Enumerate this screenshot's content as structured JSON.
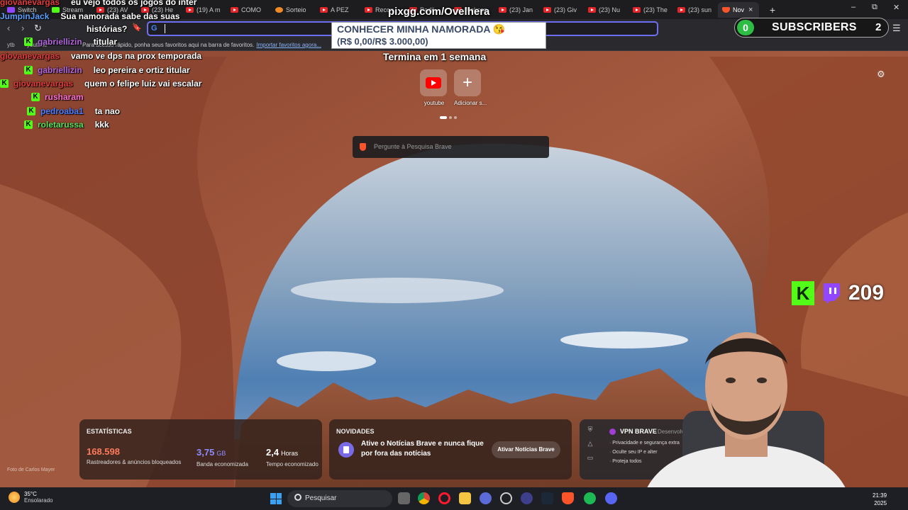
{
  "browser": {
    "tabs": [
      {
        "label": "Switch",
        "icon": "twitch-icon"
      },
      {
        "label": "Stream",
        "icon": "kick-icon"
      },
      {
        "label": "(23) AV",
        "icon": "youtube-icon"
      },
      {
        "label": "(23) He",
        "icon": "youtube-icon"
      },
      {
        "label": "(19) A m",
        "icon": "youtube-icon"
      },
      {
        "label": "COMO",
        "icon": "youtube-icon"
      },
      {
        "label": "Sorteio",
        "icon": "orange-icon"
      },
      {
        "label": "A PEZ",
        "icon": "youtube-icon"
      },
      {
        "label": "Recon",
        "icon": "youtube-icon"
      },
      {
        "label": "Padil",
        "icon": "youtube-icon"
      },
      {
        "label": "Aleksan",
        "icon": "youtube-icon"
      },
      {
        "label": "(23) Jan",
        "icon": "youtube-icon"
      },
      {
        "label": "(23) Giv",
        "icon": "youtube-icon"
      },
      {
        "label": "(23) Nu",
        "icon": "youtube-icon"
      },
      {
        "label": "(23) The",
        "icon": "youtube-icon"
      },
      {
        "label": "(23) sun",
        "icon": "youtube-icon"
      }
    ],
    "active_tab": {
      "label": "Nov",
      "close": "×"
    },
    "new_tab": "+",
    "window_controls": {
      "minimize": "–",
      "restore": "⧉",
      "close": "✕"
    },
    "nav": {
      "back": "‹",
      "forward": "›",
      "reload": "↻",
      "bookmark": "🔖"
    },
    "omnibox": {
      "engine_glyph": "G",
      "value": ""
    },
    "bookmarks_bar": {
      "text": "Para acesso rápido, ponha seus favoritos aqui na barra de favoritos.",
      "link": "Importar favoritos agora...",
      "left_labels": [
        "ytb",
        "youtube"
      ]
    },
    "menu_glyph": "☰"
  },
  "overlay": {
    "pix_url": "pixgg.com/Ovelhera",
    "goal_title": "CONHECER MINHA NAMORADA 😘",
    "goal_progress": "(R$ 0,00/R$ 3.000,00)",
    "goal_end": "Termina em 1 semana",
    "subs_count": "0",
    "subs_label": "SUBSCRIBERS",
    "subs_right": "2",
    "viewer_count": "209",
    "chat": [
      {
        "user": "giovanevargas",
        "color": "#e23b3b",
        "msg": "eu vejo todos os jogos do inter",
        "badge": false
      },
      {
        "user": "JumpinJack",
        "color": "#5aa0ff",
        "msg": "Sua namorada sabe das suas",
        "badge": false
      },
      {
        "user": "",
        "color": "#ffffff",
        "msg": "histórias?",
        "badge": false
      },
      {
        "user": "gabriellizin",
        "color": "#b467e0",
        "msg": "titular",
        "badge": true
      },
      {
        "user": "giovanevargas",
        "color": "#e23b3b",
        "msg": "vamo ve dps na prox temporada",
        "badge": false
      },
      {
        "user": "gabriellizin",
        "color": "#b467e0",
        "msg": "leo pereira e ortiz titular",
        "badge": true
      },
      {
        "user": "giovanevargas",
        "color": "#e23b3b",
        "msg": "quem o felipe luiz vai escalar",
        "badge": true
      },
      {
        "user": "rusharam",
        "color": "#ff6fd0",
        "msg": "",
        "badge": true
      },
      {
        "user": "pedroaba1",
        "color": "#4f7dff",
        "msg": "ta nao",
        "badge": true
      },
      {
        "user": "roletarussa",
        "color": "#5ae05a",
        "msg": "kkk",
        "badge": true
      }
    ]
  },
  "newtab": {
    "top_sites": [
      {
        "label": "youtube",
        "icon": "youtube-icon"
      },
      {
        "label": "Adicionar s...",
        "icon": "plus-icon"
      }
    ],
    "search_placeholder": "Pergunte à Pesquisa Brave",
    "settings_glyph": "⚙",
    "stats": {
      "title": "ESTATÍSTICAS",
      "trackers": {
        "value": "168.598",
        "desc": "Rastreadores & anúncios bloqueados",
        "color": "#ff7a5c"
      },
      "bandwidth": {
        "value": "3,75",
        "unit": "GB",
        "desc": "Banda economizada",
        "color": "#8f8cff"
      },
      "time": {
        "value": "2,4",
        "unit": "Horas",
        "desc": "Tempo economizado",
        "color": "#ffffff"
      }
    },
    "news": {
      "title": "NOVIDADES",
      "text": "Ative o Notícias Brave e nunca fique por fora das notícias",
      "button": "Ativar Notícias Brave"
    },
    "vpn": {
      "title": "VPN BRAVE",
      "status": "Desenvolvi",
      "bullets": [
        "Privacidade e segurança extra",
        "Oculte seu IP e alter",
        "Proteja todos"
      ]
    },
    "photo_credit": "Foto de Carlos Mayer"
  },
  "taskbar": {
    "temperature": "35°C",
    "weather": "Ensolarado",
    "search": "Pesquisar",
    "time": "21:39",
    "date": "2025"
  }
}
